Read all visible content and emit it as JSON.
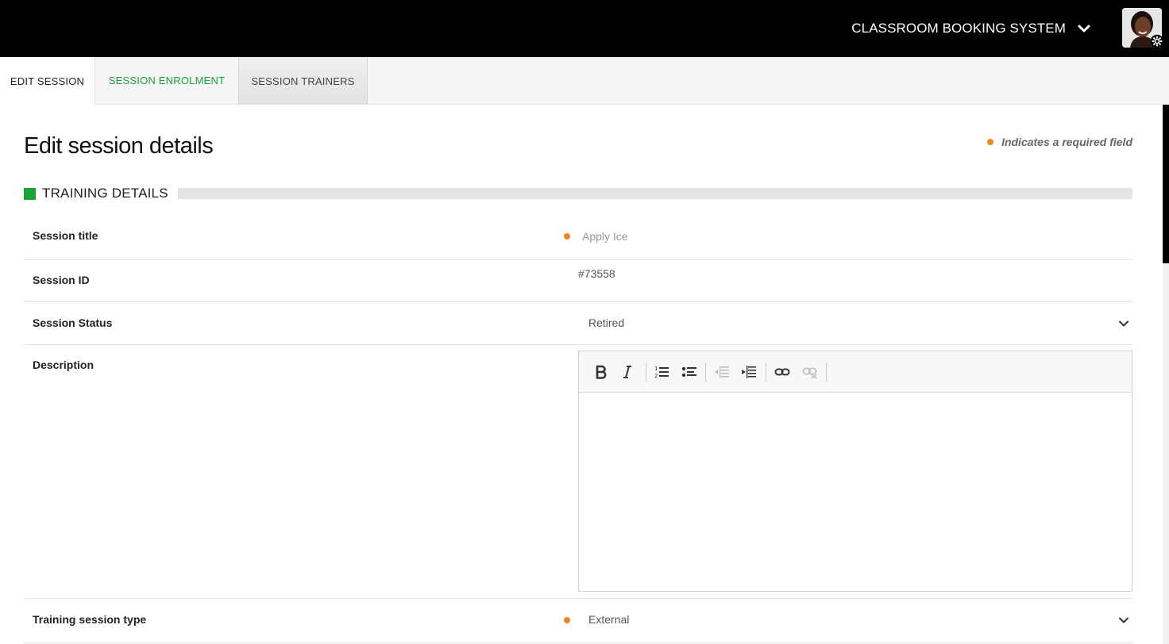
{
  "header": {
    "app_name": "CLASSROOM BOOKING SYSTEM",
    "app_menu_icon": "chevron-down-icon",
    "avatar_icon": "user-avatar",
    "settings_icon": "gear-icon"
  },
  "tabs": [
    {
      "label": "EDIT SESSION",
      "active": true
    },
    {
      "label": "SESSION ENROLMENT",
      "active": false
    },
    {
      "label": "SESSION TRAINERS",
      "active": false
    }
  ],
  "page": {
    "title": "Edit session details",
    "required_note": "Indicates a required field"
  },
  "section": {
    "label": "TRAINING DETAILS"
  },
  "fields": {
    "session_title": {
      "label": "Session title",
      "placeholder": "Apply Ice",
      "required": true
    },
    "session_id": {
      "label": "Session ID",
      "value": "#73558"
    },
    "session_status": {
      "label": "Session Status",
      "value": "Retired"
    },
    "description": {
      "label": "Description",
      "value": ""
    },
    "training_session_type": {
      "label": "Training session type",
      "value": "External",
      "required": true
    }
  },
  "editor_toolbar": [
    {
      "name": "bold-icon",
      "enabled": true
    },
    {
      "name": "italic-icon",
      "enabled": true
    },
    {
      "name": "numbered-list-icon",
      "enabled": true
    },
    {
      "name": "bulleted-list-icon",
      "enabled": true
    },
    {
      "name": "outdent-icon",
      "enabled": false
    },
    {
      "name": "indent-icon",
      "enabled": true
    },
    {
      "name": "link-icon",
      "enabled": true
    },
    {
      "name": "unlink-icon",
      "enabled": false
    }
  ],
  "colors": {
    "accent_green": "#1aa33a",
    "required_orange": "#e8862a",
    "topbar": "#000000"
  }
}
